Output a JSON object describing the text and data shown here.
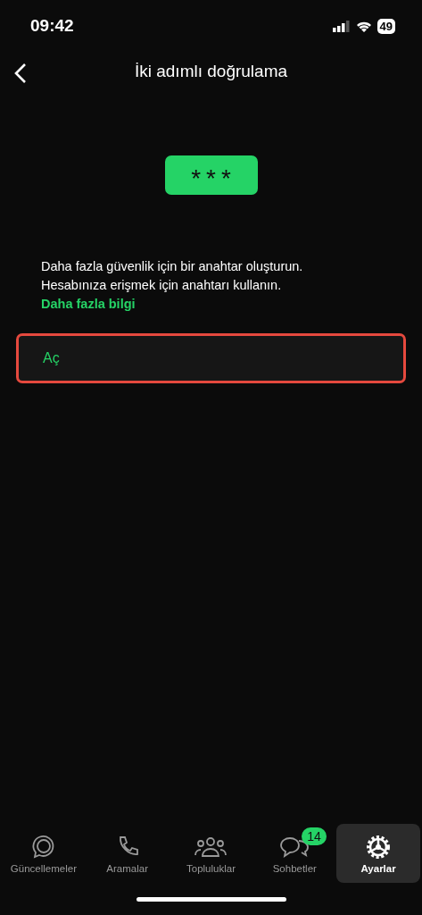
{
  "status_bar": {
    "time": "09:42",
    "battery": "49"
  },
  "header": {
    "title": "İki adımlı doğrulama"
  },
  "key_badge": {
    "text": "***"
  },
  "description": {
    "text": "Daha fazla güvenlik için bir anahtar oluşturun. Hesabınıza erişmek için anahtarı kullanın.",
    "link": "Daha fazla bilgi"
  },
  "action_row": {
    "label": "Aç",
    "highlighted": true
  },
  "tab_bar": [
    {
      "label": "Güncellemeler",
      "kind": "updates",
      "selected": false
    },
    {
      "label": "Aramalar",
      "kind": "calls",
      "selected": false
    },
    {
      "label": "Topluluklar",
      "kind": "communities",
      "selected": false
    },
    {
      "label": "Sohbetler",
      "kind": "chats",
      "selected": false,
      "badge": "14"
    },
    {
      "label": "Ayarlar",
      "kind": "settings",
      "selected": true
    }
  ]
}
